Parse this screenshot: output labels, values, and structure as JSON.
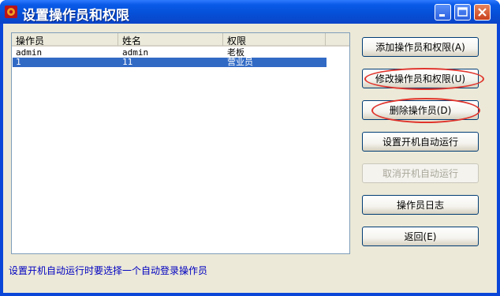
{
  "window": {
    "title": "设置操作员和权限"
  },
  "table": {
    "columns": [
      "操作员",
      "姓名",
      "权限"
    ],
    "rows": [
      [
        "admin",
        "admin",
        "老板"
      ],
      [
        "1",
        "11",
        "营业员"
      ]
    ]
  },
  "buttons": {
    "add": "添加操作员和权限(A)",
    "modify": "修改操作员和权限(U)",
    "delete": "删除操作员(D)",
    "set_autorun": "设置开机自动运行",
    "cancel_autorun": "取消开机自动运行",
    "log": "操作员日志",
    "back": "返回(E)"
  },
  "hint": "设置开机自动运行时要选择一个自动登录操作员",
  "colors": {
    "annotation": "#e0342c",
    "selection": "#316ac5",
    "hint_text": "#0000c0"
  }
}
